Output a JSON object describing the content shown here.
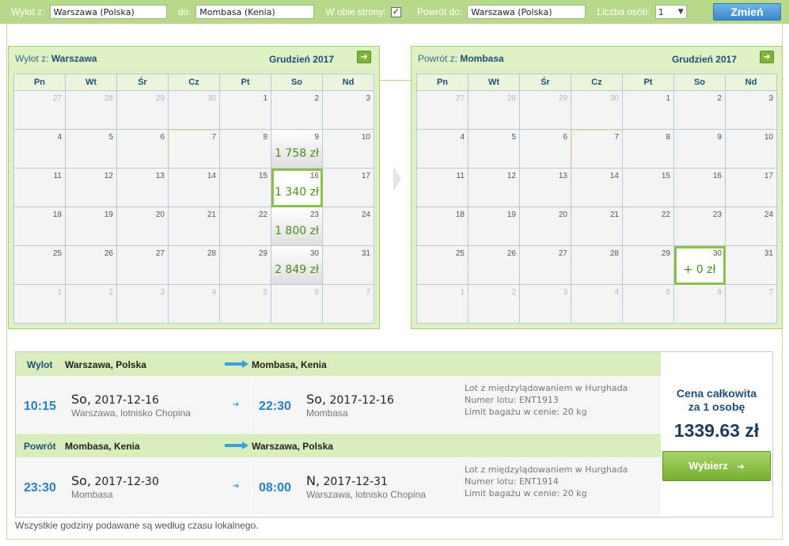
{
  "search": {
    "from_label": "Wylot z:",
    "from_value": "Warszawa (Polska)",
    "to_label": "do:",
    "to_value": "Mombasa (Kenia)",
    "roundtrip_label": "W obie strony:",
    "roundtrip_checked": "✓",
    "return_label": "Powrót do:",
    "return_value": "Warszawa (Polska)",
    "persons_label": "Liczba osób:",
    "persons_value": "1",
    "change_button": "Zmień"
  },
  "outbound_calendar": {
    "title_prefix": "Wylot z:",
    "title_city": "Warszawa",
    "month": "Grudzień 2017",
    "next_icon": "arrow-right-icon",
    "weekdays": [
      "Pn",
      "Wt",
      "Śr",
      "Cz",
      "Pt",
      "So",
      "Nd"
    ],
    "days": [
      {
        "d": "27",
        "other": true
      },
      {
        "d": "28",
        "other": true
      },
      {
        "d": "29",
        "other": true
      },
      {
        "d": "30",
        "other": true
      },
      {
        "d": "1"
      },
      {
        "d": "2"
      },
      {
        "d": "3"
      },
      {
        "d": "4"
      },
      {
        "d": "5"
      },
      {
        "d": "6"
      },
      {
        "d": "7",
        "today": true
      },
      {
        "d": "8"
      },
      {
        "d": "9",
        "price": "1 758 zł"
      },
      {
        "d": "10"
      },
      {
        "d": "11"
      },
      {
        "d": "12"
      },
      {
        "d": "13"
      },
      {
        "d": "14"
      },
      {
        "d": "15"
      },
      {
        "d": "16",
        "price": "1 340 zł",
        "selected": true
      },
      {
        "d": "17"
      },
      {
        "d": "18"
      },
      {
        "d": "19"
      },
      {
        "d": "20"
      },
      {
        "d": "21"
      },
      {
        "d": "22"
      },
      {
        "d": "23",
        "price": "1 800 zł"
      },
      {
        "d": "24"
      },
      {
        "d": "25"
      },
      {
        "d": "26"
      },
      {
        "d": "27"
      },
      {
        "d": "28"
      },
      {
        "d": "29"
      },
      {
        "d": "30",
        "price": "2 849 zł"
      },
      {
        "d": "31"
      },
      {
        "d": "1",
        "other": true
      },
      {
        "d": "2",
        "other": true
      },
      {
        "d": "3",
        "other": true
      },
      {
        "d": "4",
        "other": true
      },
      {
        "d": "5",
        "other": true
      },
      {
        "d": "6",
        "other": true
      },
      {
        "d": "7",
        "other": true
      }
    ]
  },
  "return_calendar": {
    "title_prefix": "Powrót z:",
    "title_city": "Mombasa",
    "month": "Grudzień 2017",
    "next_icon": "arrow-right-icon",
    "weekdays": [
      "Pn",
      "Wt",
      "Śr",
      "Cz",
      "Pt",
      "So",
      "Nd"
    ],
    "days": [
      {
        "d": "27",
        "other": true
      },
      {
        "d": "28",
        "other": true
      },
      {
        "d": "29",
        "other": true
      },
      {
        "d": "30",
        "other": true
      },
      {
        "d": "1"
      },
      {
        "d": "2"
      },
      {
        "d": "3"
      },
      {
        "d": "4"
      },
      {
        "d": "5"
      },
      {
        "d": "6"
      },
      {
        "d": "7",
        "today": true
      },
      {
        "d": "8"
      },
      {
        "d": "9"
      },
      {
        "d": "10"
      },
      {
        "d": "11"
      },
      {
        "d": "12"
      },
      {
        "d": "13"
      },
      {
        "d": "14"
      },
      {
        "d": "15"
      },
      {
        "d": "16"
      },
      {
        "d": "17"
      },
      {
        "d": "18"
      },
      {
        "d": "19"
      },
      {
        "d": "20"
      },
      {
        "d": "21"
      },
      {
        "d": "22"
      },
      {
        "d": "23"
      },
      {
        "d": "24"
      },
      {
        "d": "25"
      },
      {
        "d": "26"
      },
      {
        "d": "27"
      },
      {
        "d": "28"
      },
      {
        "d": "29"
      },
      {
        "d": "30",
        "price": "+ 0 zł",
        "selected": true
      },
      {
        "d": "31"
      },
      {
        "d": "1",
        "other": true
      },
      {
        "d": "2",
        "other": true
      },
      {
        "d": "3",
        "other": true
      },
      {
        "d": "4",
        "other": true
      },
      {
        "d": "5",
        "other": true
      },
      {
        "d": "6",
        "other": true
      },
      {
        "d": "7",
        "other": true
      }
    ]
  },
  "result": {
    "outbound": {
      "tag": "Wylot",
      "from": "Warszawa, Polska",
      "to": "Mombasa, Kenia",
      "dep_time": "10:15",
      "dep_weekday": "So,",
      "dep_date": "2017-12-16",
      "dep_place": "Warszawa, lotnisko Chopina",
      "arr_time": "22:30",
      "arr_weekday": "So,",
      "arr_date": "2017-12-16",
      "arr_place": "Mombasa",
      "info_1": "Lot z międzylądowaniem w Hurghada",
      "info_2": "Numer lotu: ENT1913",
      "info_3": "Limit bagażu w cenie: 20 kg"
    },
    "return": {
      "tag": "Powrót",
      "from": "Mombasa, Kenia",
      "to": "Warszawa, Polska",
      "dep_time": "23:30",
      "dep_weekday": "So,",
      "dep_date": "2017-12-30",
      "dep_place": "Mombasa",
      "arr_time": "08:00",
      "arr_weekday": "N,",
      "arr_date": "2017-12-31",
      "arr_place": "Warszawa, lotnisko Chopina",
      "info_1": "Lot z międzylądowaniem w Hurghada",
      "info_2": "Numer lotu: ENT1914",
      "info_3": "Limit bagażu w cenie: 20 kg"
    },
    "price_caption_1": "Cena całkowita",
    "price_caption_2": "za 1 osobę",
    "price_total": "1339.63 zł",
    "choose_button": "Wybierz",
    "choose_icon": "arrow-right-icon"
  },
  "footnote": "Wszystkie godziny podawane są według czasu lokalnego.",
  "colors": {
    "accent_green": "#8cc04a",
    "price_green": "#4d8a1b",
    "time_blue": "#2980c4",
    "title_navy": "#1f4e79"
  }
}
